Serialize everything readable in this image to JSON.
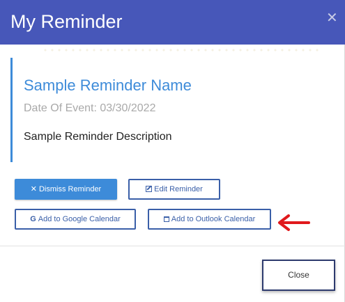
{
  "modal": {
    "title": "My Reminder",
    "close_icon": "close-icon"
  },
  "reminder": {
    "name": "Sample Reminder Name",
    "date_label": "Date Of Event: 03/30/2022",
    "description": "Sample Reminder Description"
  },
  "actions": {
    "dismiss_label": "Dismiss Reminder",
    "edit_label": "Edit Reminder",
    "google_label": "Add to Google Calendar",
    "outlook_label": "Add to Outlook Calendar"
  },
  "footer": {
    "close_label": "Close"
  },
  "colors": {
    "header": "#4757b9",
    "accent": "#3d8bd9",
    "outline": "#3a5fa8",
    "annotation_arrow": "#e0191c"
  }
}
